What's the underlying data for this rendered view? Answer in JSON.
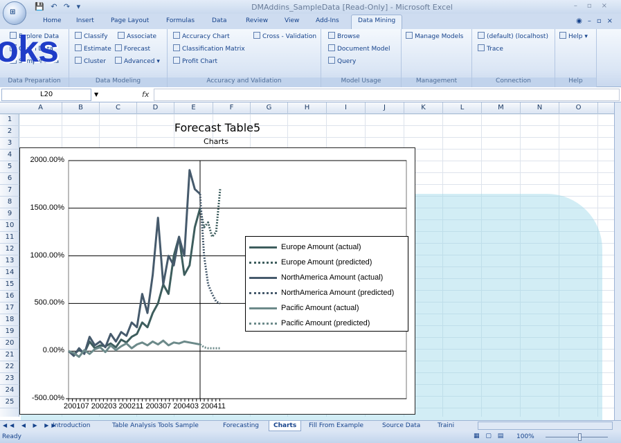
{
  "window": {
    "title": "DMAddins_SampleData  [Read-Only] - Microsoft Excel",
    "office_button": "Office",
    "qat": "💾 ↶ ↷ ▾"
  },
  "tabs": [
    "Home",
    "Insert",
    "Page Layout",
    "Formulas",
    "Data",
    "Review",
    "View",
    "Add-Ins",
    "Data Mining"
  ],
  "active_tab": "Data Mining",
  "watermark": "oks",
  "ribbon": {
    "data_preparation": {
      "label": "Data Preparation",
      "items": [
        "Explore Data",
        "Clean Data",
        "Sample Data"
      ]
    },
    "data_modeling": {
      "label": "Data Modeling",
      "items": [
        "Classify",
        "Associate",
        "Estimate",
        "Forecast",
        "Cluster",
        "Advanced"
      ]
    },
    "accuracy": {
      "label": "Accuracy and Validation",
      "items": [
        "Accuracy Chart",
        "Cross - Validation",
        "Classification Matrix",
        "Profit Chart"
      ]
    },
    "model_usage": {
      "label": "Model Usage",
      "items": [
        "Browse",
        "Document Model",
        "Query"
      ]
    },
    "management": {
      "label": "Management",
      "items": [
        "Manage Models"
      ]
    },
    "connection": {
      "label": "Connection",
      "items": [
        "(default) (localhost)",
        "Trace"
      ]
    },
    "help": {
      "label": "Help",
      "items": [
        "Help"
      ]
    }
  },
  "formula_bar": {
    "name_box": "L20",
    "fx": "fx",
    "value": ""
  },
  "columns": [
    "A",
    "B",
    "C",
    "D",
    "E",
    "F",
    "G",
    "H",
    "I",
    "J",
    "K",
    "L",
    "M",
    "N",
    "O"
  ],
  "rows": [
    "1",
    "2",
    "3",
    "4",
    "5",
    "6",
    "7",
    "8",
    "9",
    "10",
    "11",
    "12",
    "13",
    "14",
    "15",
    "16",
    "17",
    "18",
    "19",
    "20",
    "21",
    "22",
    "23",
    "24",
    "25"
  ],
  "sheet": {
    "title": "Forecast Table5",
    "subtitle": "Charts"
  },
  "chart_data": {
    "type": "line",
    "y_ticks": [
      "2000.00%",
      "1500.00%",
      "1000.00%",
      "500.00%",
      "0.00%",
      "-500.00%"
    ],
    "ylim": [
      -500,
      2000
    ],
    "x_ticks": [
      "200107",
      "200203",
      "200211",
      "200307",
      "200403",
      "200411"
    ],
    "legend": [
      "Europe Amount (actual)",
      "Europe Amount (predicted)",
      "NorthAmerica Amount (actual)",
      "NorthAmerica Amount (predicted)",
      "Pacific Amount (actual)",
      "Pacific Amount (predicted)"
    ],
    "series": [
      {
        "name": "Europe Amount (actual)",
        "style": "solid",
        "values": [
          0,
          -30,
          10,
          -20,
          100,
          30,
          60,
          50,
          80,
          40,
          120,
          90,
          150,
          180,
          300,
          250,
          400,
          500,
          700,
          600,
          1000,
          1200,
          800,
          900,
          1300,
          1500
        ]
      },
      {
        "name": "Europe Amount (predicted)",
        "style": "dotted",
        "values": [
          1500,
          1300,
          1350,
          1200,
          1250,
          1700
        ]
      },
      {
        "name": "NorthAmerica Amount (actual)",
        "style": "solid",
        "values": [
          0,
          -50,
          30,
          -30,
          150,
          60,
          100,
          40,
          180,
          100,
          200,
          160,
          300,
          250,
          600,
          400,
          800,
          1400,
          700,
          1000,
          900,
          1200,
          1000,
          1900,
          1700,
          1650
        ]
      },
      {
        "name": "NorthAmerica Amount (predicted)",
        "style": "dotted",
        "values": [
          1650,
          1000,
          700,
          600,
          520,
          500
        ]
      },
      {
        "name": "Pacific Amount (actual)",
        "style": "solid",
        "values": [
          0,
          -20,
          -60,
          10,
          -30,
          20,
          40,
          -10,
          60,
          10,
          50,
          80,
          30,
          70,
          90,
          60,
          100,
          70,
          110,
          60,
          90,
          80,
          100,
          90,
          80,
          70
        ]
      },
      {
        "name": "Pacific Amount (predicted)",
        "style": "dotted",
        "values": [
          70,
          40,
          30,
          30,
          30,
          30
        ]
      }
    ]
  },
  "sheet_tabs": [
    "Introduction",
    "Table Analysis Tools Sample",
    "Forecasting",
    "Charts",
    "Fill From Example",
    "Source Data",
    "Traini"
  ],
  "active_sheet": "Charts",
  "status": {
    "text": "Ready",
    "zoom": "100%"
  }
}
